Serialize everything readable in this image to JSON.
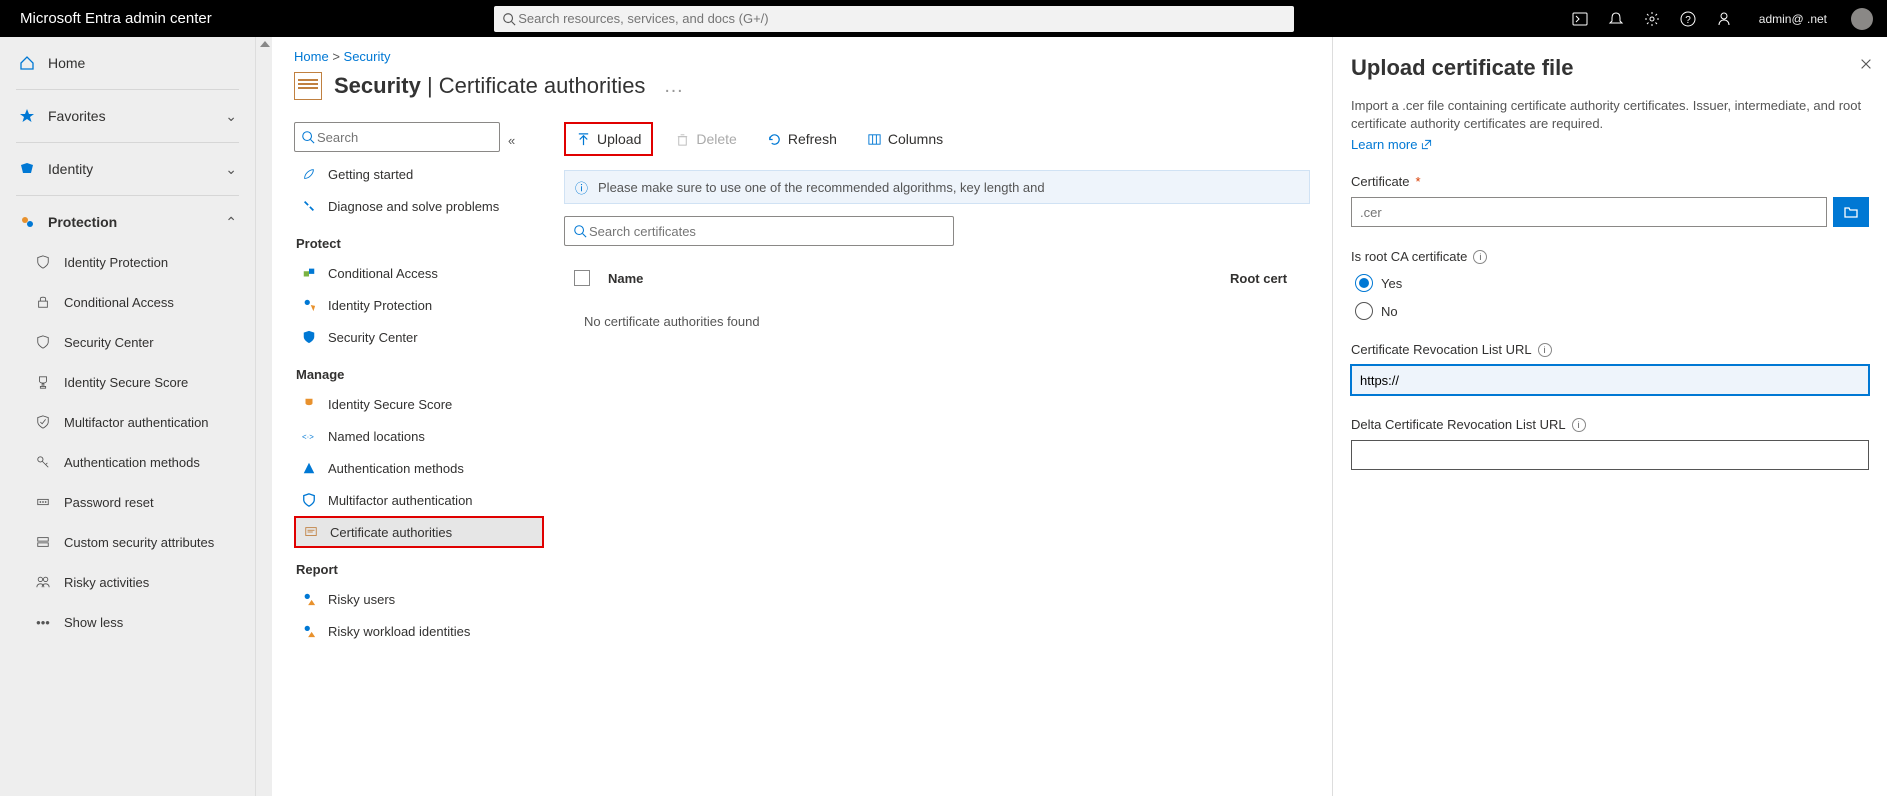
{
  "header": {
    "brand": "Microsoft Entra admin center",
    "search_placeholder": "Search resources, services, and docs (G+/)",
    "user": "admin@ .net"
  },
  "sidebar": {
    "home": "Home",
    "favorites": "Favorites",
    "identity": "Identity",
    "protection": "Protection",
    "protection_items": [
      "Identity Protection",
      "Conditional Access",
      "Security Center",
      "Identity Secure Score",
      "Multifactor authentication",
      "Authentication methods",
      "Password reset",
      "Custom security attributes",
      "Risky activities"
    ],
    "show_less": "Show less"
  },
  "breadcrumb": {
    "home": "Home",
    "security": "Security"
  },
  "title": {
    "main": "Security",
    "sub": "Certificate authorities"
  },
  "subnav": {
    "search_placeholder": "Search",
    "top": [
      "Getting started",
      "Diagnose and solve problems"
    ],
    "protect_heading": "Protect",
    "protect": [
      "Conditional Access",
      "Identity Protection",
      "Security Center"
    ],
    "manage_heading": "Manage",
    "manage": [
      "Identity Secure Score",
      "Named locations",
      "Authentication methods",
      "Multifactor authentication",
      "Certificate authorities"
    ],
    "report_heading": "Report",
    "report": [
      "Risky users",
      "Risky workload identities"
    ]
  },
  "toolbar": {
    "upload": "Upload",
    "delete": "Delete",
    "refresh": "Refresh",
    "columns": "Columns"
  },
  "info_bar": "Please make sure to use one of the recommended algorithms, key length and",
  "cert_search_placeholder": "Search certificates",
  "table": {
    "col_name": "Name",
    "col_root": "Root cert",
    "empty": "No certificate authorities found"
  },
  "panel": {
    "title": "Upload certificate file",
    "desc": "Import a .cer file containing certificate authority certificates. Issuer, intermediate, and root certificate authority certificates are required.",
    "learn_more": "Learn more",
    "certificate_label": "Certificate",
    "certificate_placeholder": ".cer",
    "is_root_label": "Is root CA certificate",
    "yes": "Yes",
    "no": "No",
    "crl_label": "Certificate Revocation List URL",
    "crl_value": "https://",
    "delta_crl_label": "Delta Certificate Revocation List URL"
  }
}
